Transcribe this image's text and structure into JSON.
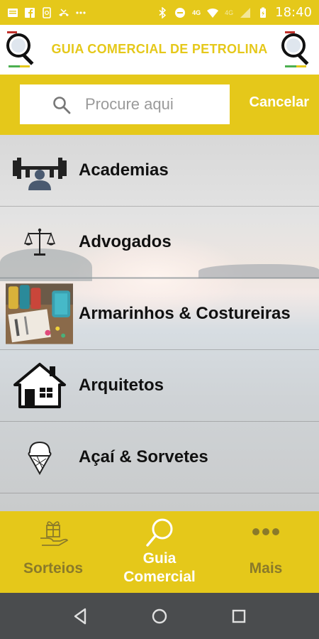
{
  "status_bar": {
    "time": "18:40",
    "network_label": "4G",
    "network_label2": "4G"
  },
  "header": {
    "title": "GUIA COMERCIAL DE PETROLINA"
  },
  "search": {
    "placeholder": "Procure aqui",
    "value": "",
    "cancel_label": "Cancelar"
  },
  "categories": [
    {
      "label": "Academias",
      "icon": "weightlifting-icon"
    },
    {
      "label": "Advogados",
      "icon": "scales-of-justice-icon"
    },
    {
      "label": "Armarinhos & Costureiras",
      "icon": "sewing-thread-photo"
    },
    {
      "label": "Arquitetos",
      "icon": "house-icon"
    },
    {
      "label": "Açaí & Sorvetes",
      "icon": "ice-cream-cone-icon"
    }
  ],
  "bottom_nav": [
    {
      "label": "Sorteios",
      "icon": "gift-hand-icon",
      "active": false
    },
    {
      "label": "Guia Comercial",
      "icon": "search-icon",
      "active": true
    },
    {
      "label": "Mais",
      "icon": "more-dots-icon",
      "active": false
    }
  ],
  "colors": {
    "accent": "#e5c81a",
    "nav_bar": "#4a4c4e",
    "inactive_label": "#8a7a2a"
  }
}
